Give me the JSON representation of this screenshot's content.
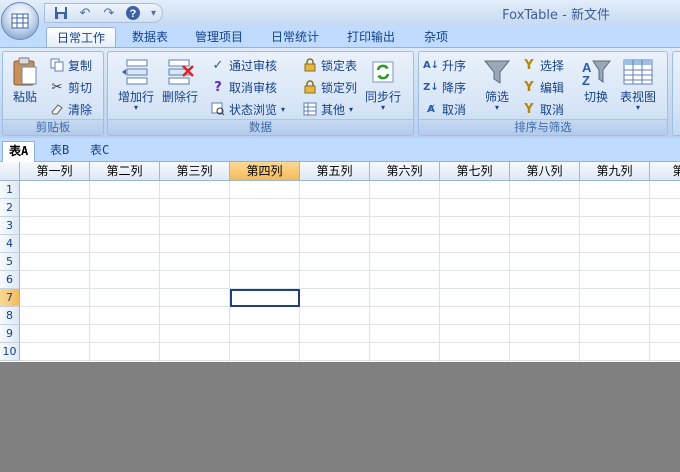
{
  "window": {
    "title": "FoxTable - 新文件"
  },
  "qat": {
    "items": [
      "save-icon",
      "undo-icon",
      "redo-icon",
      "help-icon"
    ],
    "customize": "="
  },
  "ribbon_tabs": [
    {
      "label": "日常工作",
      "active": true
    },
    {
      "label": "数据表",
      "active": false
    },
    {
      "label": "管理项目",
      "active": false
    },
    {
      "label": "日常统计",
      "active": false
    },
    {
      "label": "打印输出",
      "active": false
    },
    {
      "label": "杂项",
      "active": false
    }
  ],
  "groups": {
    "clipboard": {
      "label": "剪贴板",
      "paste": "粘贴",
      "copy": "复制",
      "cut": "剪切",
      "clear": "清除"
    },
    "data": {
      "label": "数据",
      "add_row": "增加行",
      "delete_row": "删除行",
      "approve": "通过审核",
      "unapprove": "取消审核",
      "status_browse": "状态浏览",
      "lock_table": "锁定表",
      "lock_column": "锁定列",
      "other": "其他",
      "sync_row": "同步行"
    },
    "sort_filter": {
      "label": "排序与筛选",
      "asc": "升序",
      "desc": "降序",
      "cancel_sort": "取消",
      "filter": "筛选",
      "select": "选择",
      "edit": "编辑",
      "cancel_filter": "取消",
      "switch": "切换",
      "table_view": "表视图"
    }
  },
  "sheet_tabs": [
    {
      "label": "表A",
      "active": true
    },
    {
      "label": "表B",
      "active": false
    },
    {
      "label": "表C",
      "active": false
    }
  ],
  "grid": {
    "columns": [
      "第一列",
      "第二列",
      "第三列",
      "第四列",
      "第五列",
      "第六列",
      "第七列",
      "第八列",
      "第九列",
      "第十"
    ],
    "rows": [
      "1",
      "2",
      "3",
      "4",
      "5",
      "6",
      "7",
      "8",
      "9",
      "10"
    ],
    "selected_column": "第四列",
    "selected_row": "7"
  },
  "colors": {
    "ribbon": "#c7daf2",
    "selection_header": "#f4ba5b",
    "active_cell_border": "#1f3f7d",
    "empty_area": "#808080"
  }
}
